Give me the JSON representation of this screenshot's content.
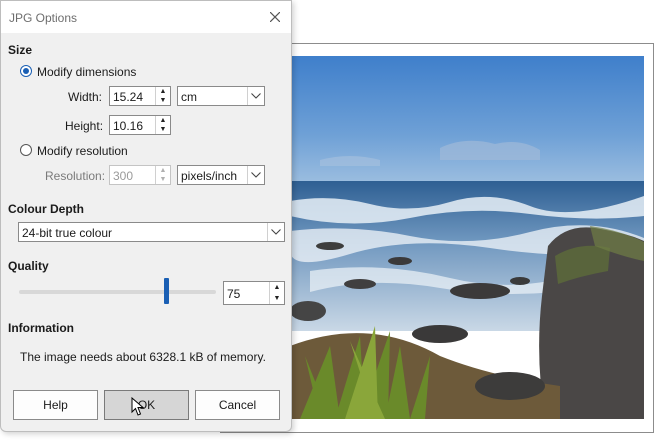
{
  "dialog": {
    "title": "JPG Options",
    "close_icon": "close-icon"
  },
  "size": {
    "heading": "Size",
    "modify_dimensions_label": "Modify dimensions",
    "modify_dimensions_selected": true,
    "width_label": "Width:",
    "width_value": "15.24",
    "height_label": "Height:",
    "height_value": "10.16",
    "unit_value": "cm",
    "modify_resolution_label": "Modify resolution",
    "resolution_label": "Resolution:",
    "resolution_value": "300",
    "resolution_unit_value": "pixels/inch"
  },
  "colour_depth": {
    "heading": "Colour Depth",
    "selected": "24-bit true colour"
  },
  "quality": {
    "heading": "Quality",
    "value": "75",
    "slider_fraction": 0.75
  },
  "information": {
    "heading": "Information",
    "text": "The image needs about 6328.1 kB of memory."
  },
  "buttons": {
    "help": "Help",
    "ok": "OK",
    "cancel": "Cancel"
  },
  "colors": {
    "accent": "#1a5fb4"
  }
}
